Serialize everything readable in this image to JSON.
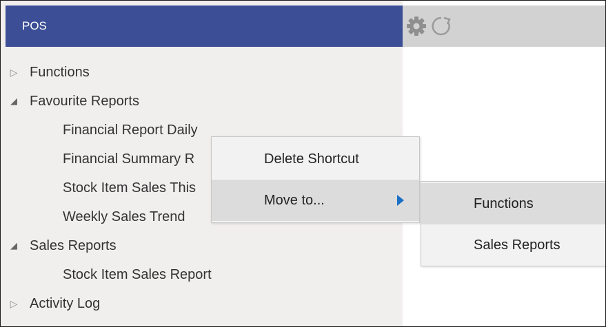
{
  "header": {
    "title": "POS"
  },
  "toolbar": {
    "settings_icon": "gear-icon",
    "refresh_icon": "refresh-icon"
  },
  "tree": {
    "functions": "Functions",
    "favourite_reports": "Favourite Reports",
    "favourite_items": [
      "Financial Report Daily",
      "Financial Summary R",
      "Stock Item Sales This",
      "Weekly Sales Trend"
    ],
    "sales_reports": "Sales Reports",
    "sales_items": [
      "Stock Item Sales Report"
    ],
    "activity_log": "Activity Log"
  },
  "context_menu": {
    "delete_shortcut": "Delete Shortcut",
    "move_to": "Move to..."
  },
  "submenu": {
    "items": [
      "Functions",
      "Sales Reports"
    ]
  },
  "colors": {
    "header_bg": "#3b4e96",
    "tree_bg": "#f1eeee",
    "submenu_arrow": "#1b6fc4"
  }
}
